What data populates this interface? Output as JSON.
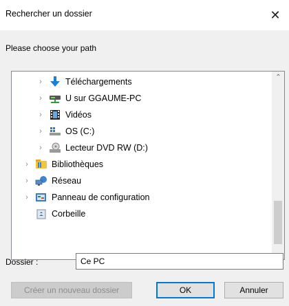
{
  "window": {
    "title": "Rechercher un dossier",
    "close_glyph": "✕"
  },
  "prompt": "Please choose your path",
  "tree": {
    "items": [
      {
        "label": "Téléchargements",
        "icon": "download-arrow-icon",
        "level": 2
      },
      {
        "label": "U sur GGAUME-PC",
        "icon": "network-drive-icon",
        "level": 2
      },
      {
        "label": "Vidéos",
        "icon": "videos-folder-icon",
        "level": 2
      },
      {
        "label": "OS (C:)",
        "icon": "windows-drive-icon",
        "level": 2
      },
      {
        "label": "Lecteur DVD RW (D:)",
        "icon": "dvd-drive-icon",
        "level": 2
      },
      {
        "label": "Bibliothèques",
        "icon": "libraries-icon",
        "level": 1
      },
      {
        "label": "Réseau",
        "icon": "network-icon",
        "level": 1
      },
      {
        "label": "Panneau de configuration",
        "icon": "control-panel-icon",
        "level": 1
      },
      {
        "label": "Corbeille",
        "icon": "recycle-bin-icon",
        "level": 1
      }
    ],
    "chevron": "›",
    "scroll_up": "⌃",
    "scroll_down": "⌄"
  },
  "folder": {
    "label": "Dossier :",
    "value": "Ce PC"
  },
  "buttons": {
    "new_folder": "Créer un nouveau dossier",
    "ok": "OK",
    "cancel": "Annuler"
  },
  "colors": {
    "accent": "#0078d7",
    "download_blue": "#1e7fd9",
    "folder_yellow": "#f3c443"
  }
}
